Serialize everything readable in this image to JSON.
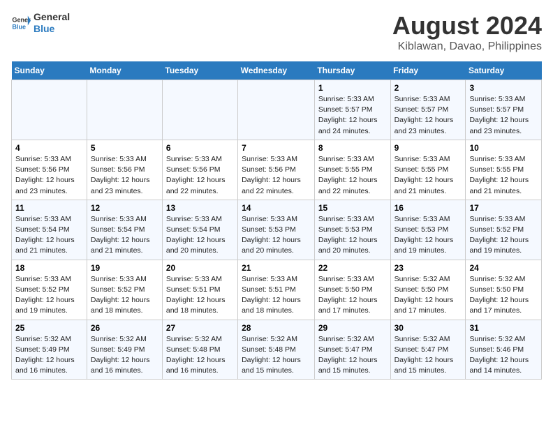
{
  "logo": {
    "name": "General",
    "name2": "Blue"
  },
  "title": "August 2024",
  "subtitle": "Kiblawan, Davao, Philippines",
  "days_of_week": [
    "Sunday",
    "Monday",
    "Tuesday",
    "Wednesday",
    "Thursday",
    "Friday",
    "Saturday"
  ],
  "weeks": [
    [
      {
        "day": "",
        "info": ""
      },
      {
        "day": "",
        "info": ""
      },
      {
        "day": "",
        "info": ""
      },
      {
        "day": "",
        "info": ""
      },
      {
        "day": "1",
        "info": "Sunrise: 5:33 AM\nSunset: 5:57 PM\nDaylight: 12 hours and 24 minutes."
      },
      {
        "day": "2",
        "info": "Sunrise: 5:33 AM\nSunset: 5:57 PM\nDaylight: 12 hours and 23 minutes."
      },
      {
        "day": "3",
        "info": "Sunrise: 5:33 AM\nSunset: 5:57 PM\nDaylight: 12 hours and 23 minutes."
      }
    ],
    [
      {
        "day": "4",
        "info": "Sunrise: 5:33 AM\nSunset: 5:56 PM\nDaylight: 12 hours and 23 minutes."
      },
      {
        "day": "5",
        "info": "Sunrise: 5:33 AM\nSunset: 5:56 PM\nDaylight: 12 hours and 23 minutes."
      },
      {
        "day": "6",
        "info": "Sunrise: 5:33 AM\nSunset: 5:56 PM\nDaylight: 12 hours and 22 minutes."
      },
      {
        "day": "7",
        "info": "Sunrise: 5:33 AM\nSunset: 5:56 PM\nDaylight: 12 hours and 22 minutes."
      },
      {
        "day": "8",
        "info": "Sunrise: 5:33 AM\nSunset: 5:55 PM\nDaylight: 12 hours and 22 minutes."
      },
      {
        "day": "9",
        "info": "Sunrise: 5:33 AM\nSunset: 5:55 PM\nDaylight: 12 hours and 21 minutes."
      },
      {
        "day": "10",
        "info": "Sunrise: 5:33 AM\nSunset: 5:55 PM\nDaylight: 12 hours and 21 minutes."
      }
    ],
    [
      {
        "day": "11",
        "info": "Sunrise: 5:33 AM\nSunset: 5:54 PM\nDaylight: 12 hours and 21 minutes."
      },
      {
        "day": "12",
        "info": "Sunrise: 5:33 AM\nSunset: 5:54 PM\nDaylight: 12 hours and 21 minutes."
      },
      {
        "day": "13",
        "info": "Sunrise: 5:33 AM\nSunset: 5:54 PM\nDaylight: 12 hours and 20 minutes."
      },
      {
        "day": "14",
        "info": "Sunrise: 5:33 AM\nSunset: 5:53 PM\nDaylight: 12 hours and 20 minutes."
      },
      {
        "day": "15",
        "info": "Sunrise: 5:33 AM\nSunset: 5:53 PM\nDaylight: 12 hours and 20 minutes."
      },
      {
        "day": "16",
        "info": "Sunrise: 5:33 AM\nSunset: 5:53 PM\nDaylight: 12 hours and 19 minutes."
      },
      {
        "day": "17",
        "info": "Sunrise: 5:33 AM\nSunset: 5:52 PM\nDaylight: 12 hours and 19 minutes."
      }
    ],
    [
      {
        "day": "18",
        "info": "Sunrise: 5:33 AM\nSunset: 5:52 PM\nDaylight: 12 hours and 19 minutes."
      },
      {
        "day": "19",
        "info": "Sunrise: 5:33 AM\nSunset: 5:52 PM\nDaylight: 12 hours and 18 minutes."
      },
      {
        "day": "20",
        "info": "Sunrise: 5:33 AM\nSunset: 5:51 PM\nDaylight: 12 hours and 18 minutes."
      },
      {
        "day": "21",
        "info": "Sunrise: 5:33 AM\nSunset: 5:51 PM\nDaylight: 12 hours and 18 minutes."
      },
      {
        "day": "22",
        "info": "Sunrise: 5:33 AM\nSunset: 5:50 PM\nDaylight: 12 hours and 17 minutes."
      },
      {
        "day": "23",
        "info": "Sunrise: 5:32 AM\nSunset: 5:50 PM\nDaylight: 12 hours and 17 minutes."
      },
      {
        "day": "24",
        "info": "Sunrise: 5:32 AM\nSunset: 5:50 PM\nDaylight: 12 hours and 17 minutes."
      }
    ],
    [
      {
        "day": "25",
        "info": "Sunrise: 5:32 AM\nSunset: 5:49 PM\nDaylight: 12 hours and 16 minutes."
      },
      {
        "day": "26",
        "info": "Sunrise: 5:32 AM\nSunset: 5:49 PM\nDaylight: 12 hours and 16 minutes."
      },
      {
        "day": "27",
        "info": "Sunrise: 5:32 AM\nSunset: 5:48 PM\nDaylight: 12 hours and 16 minutes."
      },
      {
        "day": "28",
        "info": "Sunrise: 5:32 AM\nSunset: 5:48 PM\nDaylight: 12 hours and 15 minutes."
      },
      {
        "day": "29",
        "info": "Sunrise: 5:32 AM\nSunset: 5:47 PM\nDaylight: 12 hours and 15 minutes."
      },
      {
        "day": "30",
        "info": "Sunrise: 5:32 AM\nSunset: 5:47 PM\nDaylight: 12 hours and 15 minutes."
      },
      {
        "day": "31",
        "info": "Sunrise: 5:32 AM\nSunset: 5:46 PM\nDaylight: 12 hours and 14 minutes."
      }
    ]
  ]
}
